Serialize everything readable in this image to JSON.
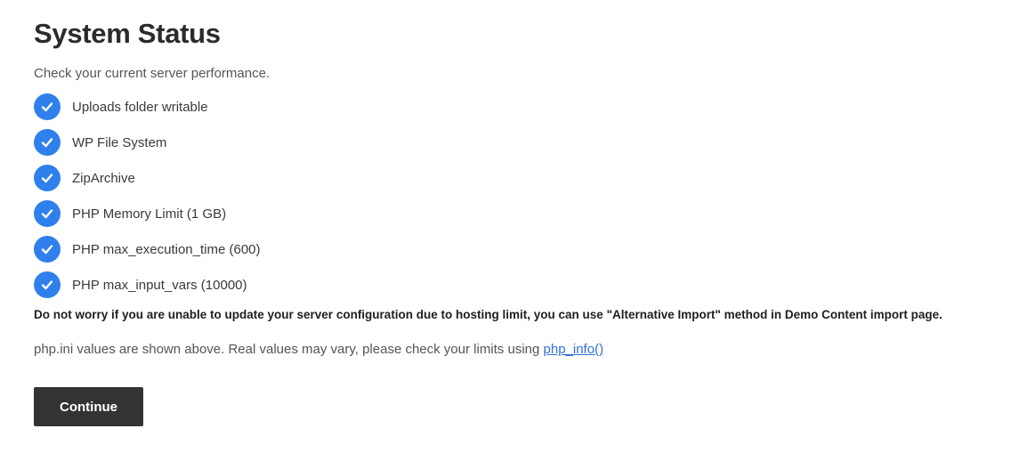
{
  "page": {
    "title": "System Status",
    "subtitle": "Check your current server performance."
  },
  "checks": [
    {
      "label": "Uploads folder writable",
      "status": "ok",
      "icon": "check-icon"
    },
    {
      "label": "WP File System",
      "status": "ok",
      "icon": "check-icon"
    },
    {
      "label": "ZipArchive",
      "status": "ok",
      "icon": "check-icon"
    },
    {
      "label": "PHP Memory Limit (1 GB)",
      "status": "ok",
      "icon": "check-icon"
    },
    {
      "label": "PHP max_execution_time (600)",
      "status": "ok",
      "icon": "check-icon"
    },
    {
      "label": "PHP max_input_vars (10000)",
      "status": "ok",
      "icon": "check-icon"
    }
  ],
  "notice": "Do not worry if you are unable to update your server configuration due to hosting limit, you can use \"Alternative Import\" method in Demo Content import page.",
  "note": {
    "text": "php.ini values are shown above. Real values may vary, please check your limits using ",
    "link_label": "php_info()"
  },
  "continue_label": "Continue",
  "colors": {
    "check_blue": "#2f80ed",
    "button_bg": "#333333",
    "link": "#2f6fd6"
  }
}
